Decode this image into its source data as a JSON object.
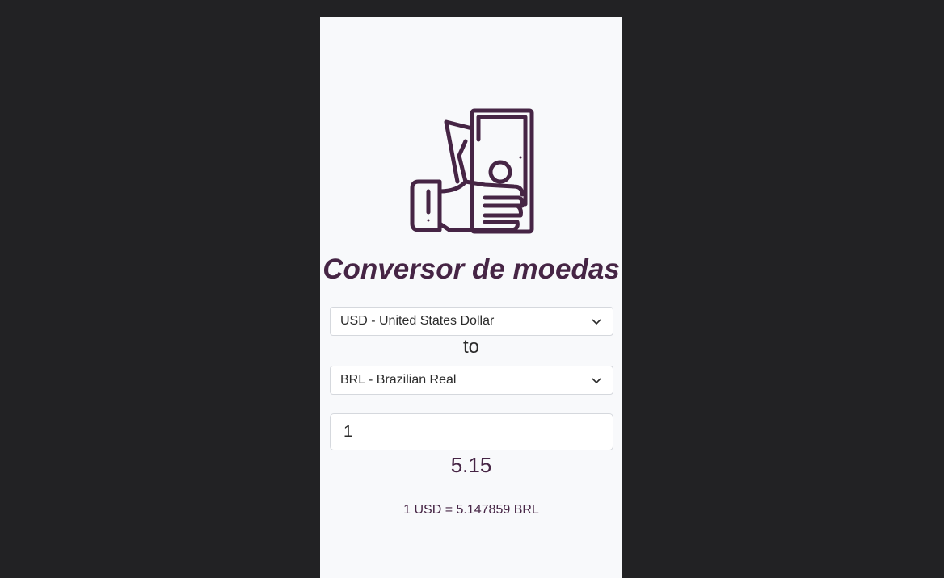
{
  "app": {
    "title": "Conversor de moedas",
    "logo_icon": "hand-holding-money-icon",
    "accent_color": "#462545",
    "background_color": "#222224",
    "card_color": "#f8f9fb"
  },
  "converter": {
    "from_currency": "USD - United States Dollar",
    "separator": "to",
    "to_currency": "BRL - Brazilian Real",
    "amount_value": "1",
    "result": "5.15",
    "rate_text": "1 USD = 5.147859 BRL"
  }
}
